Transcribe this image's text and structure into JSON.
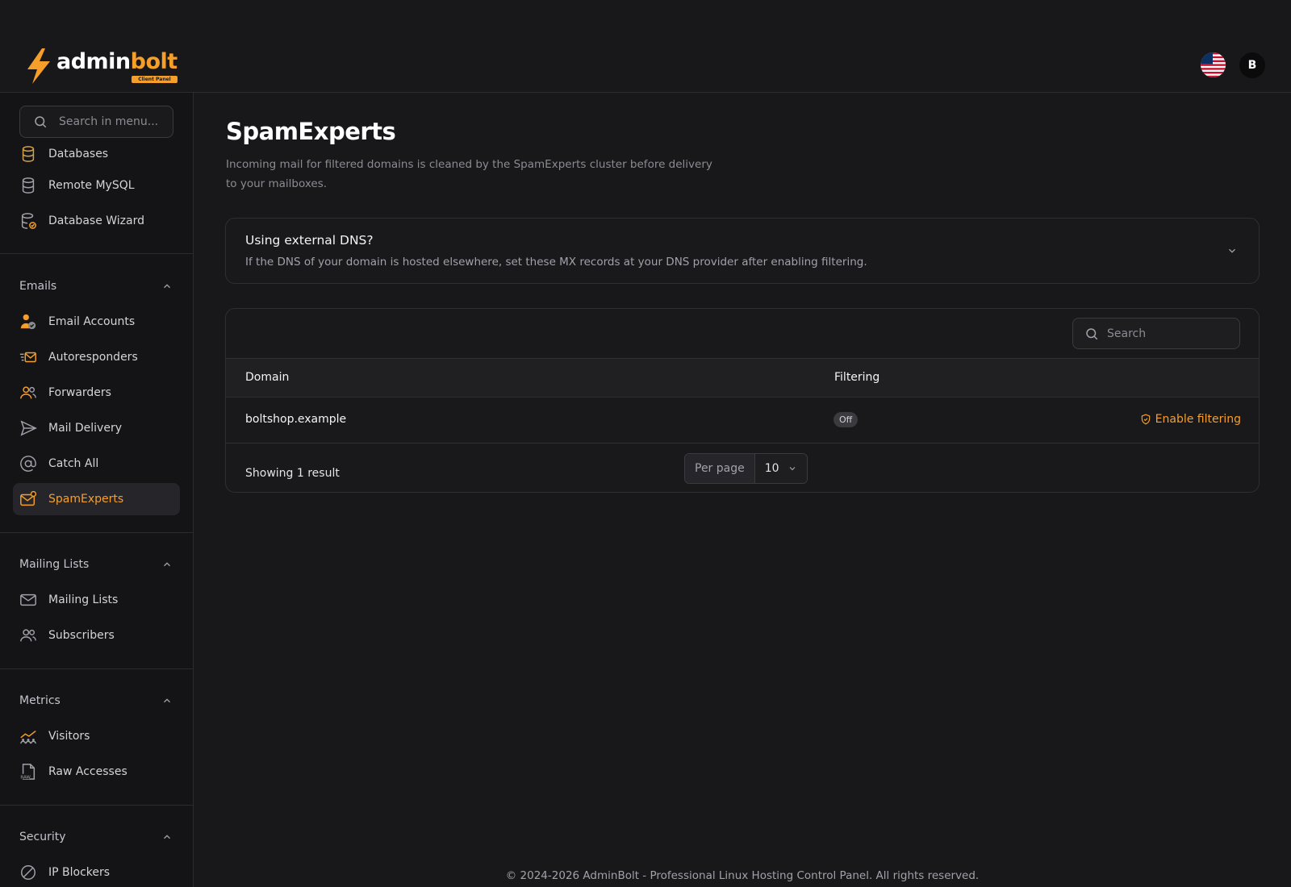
{
  "brand": {
    "word_a": "admin",
    "word_b": "bolt",
    "badge": "Client Panel"
  },
  "header": {
    "avatar_initial": "B",
    "language_icon": "us-flag-icon"
  },
  "sidebar": {
    "search_placeholder": "Search in menu...",
    "top_items": [
      {
        "label": "Databases",
        "icon": "database-icon"
      },
      {
        "label": "Remote MySQL",
        "icon": "database-icon"
      },
      {
        "label": "Database Wizard",
        "icon": "database-wizard-icon"
      }
    ],
    "sections": {
      "emails": {
        "title": "Emails",
        "items": [
          {
            "label": "Email Accounts",
            "icon": "user-check-icon"
          },
          {
            "label": "Autoresponders",
            "icon": "fast-mail-icon"
          },
          {
            "label": "Forwarders",
            "icon": "users-icon"
          },
          {
            "label": "Mail Delivery",
            "icon": "send-icon"
          },
          {
            "label": "Catch All",
            "icon": "at-icon"
          },
          {
            "label": "SpamExperts",
            "icon": "mail-alert-icon"
          }
        ]
      },
      "mailing_lists": {
        "title": "Mailing Lists",
        "items": [
          {
            "label": "Mailing Lists",
            "icon": "mail-icon"
          },
          {
            "label": "Subscribers",
            "icon": "users-icon"
          }
        ]
      },
      "metrics": {
        "title": "Metrics",
        "items": [
          {
            "label": "Visitors",
            "icon": "visitors-chart-icon"
          },
          {
            "label": "Raw Accesses",
            "icon": "raw-file-icon"
          }
        ]
      },
      "security": {
        "title": "Security",
        "items": [
          {
            "label": "IP Blockers",
            "icon": "block-icon"
          }
        ]
      }
    },
    "active_item": "SpamExperts"
  },
  "main": {
    "title": "SpamExperts",
    "description": "Incoming mail for filtered domains is cleaned by the SpamExperts cluster before delivery to your mailboxes.",
    "dns_card": {
      "title": "Using external DNS?",
      "text": "If the DNS of your domain is hosted elsewhere, set these MX records at your DNS provider after enabling filtering."
    },
    "table": {
      "search_placeholder": "Search",
      "columns": [
        "Domain",
        "Filtering"
      ],
      "rows": [
        {
          "domain": "boltshop.example",
          "filtering": "Off",
          "action": "Enable filtering"
        }
      ],
      "summary": "Showing 1 result",
      "per_page_label": "Per page",
      "per_page_value": "10"
    }
  },
  "footer": {
    "text": "© 2024-2026 AdminBolt - Professional Linux Hosting Control Panel. All rights reserved."
  },
  "colors": {
    "accent": "#f59e2a",
    "background": "#18181b",
    "sidebar": "#141416"
  }
}
